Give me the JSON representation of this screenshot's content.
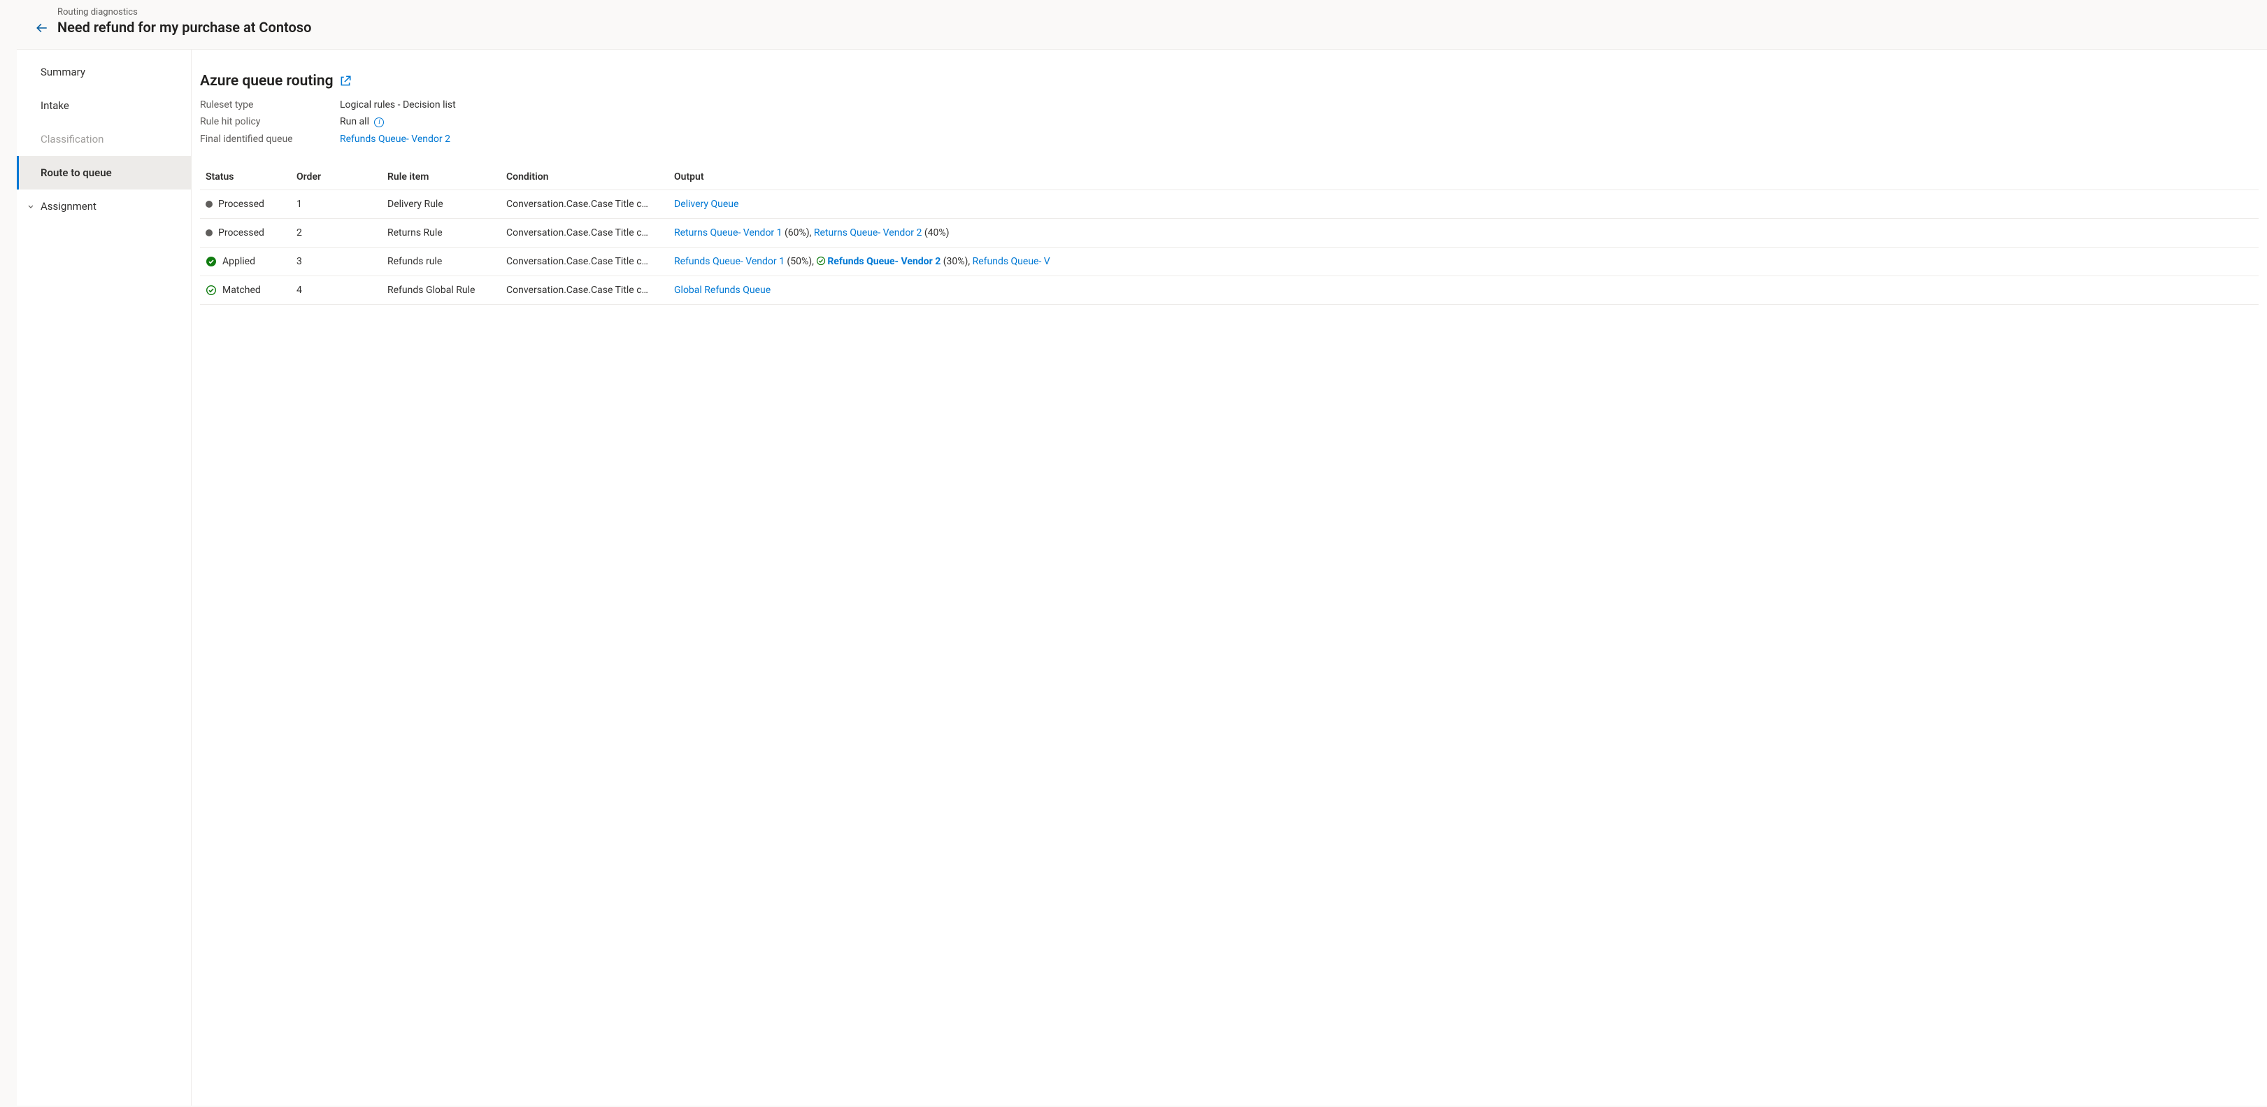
{
  "header": {
    "eyebrow": "Routing diagnostics",
    "title": "Need refund for my purchase at Contoso"
  },
  "sidebar": {
    "items": [
      {
        "label": "Summary",
        "selected": false,
        "expandable": false,
        "id": "summary"
      },
      {
        "label": "Intake",
        "selected": false,
        "expandable": false,
        "id": "intake"
      },
      {
        "label": "Classification",
        "selected": false,
        "expandable": false,
        "id": "classification",
        "disabled": true
      },
      {
        "label": "Route to queue",
        "selected": true,
        "expandable": false,
        "id": "route-to-queue"
      },
      {
        "label": "Assignment",
        "selected": false,
        "expandable": true,
        "id": "assignment"
      }
    ]
  },
  "content": {
    "title": "Azure queue routing",
    "meta": {
      "ruleset_type_label": "Ruleset type",
      "ruleset_type_value": "Logical rules - Decision list",
      "rule_hit_label": "Rule hit policy",
      "rule_hit_value": "Run all",
      "final_queue_label": "Final identified queue",
      "final_queue_value": "Refunds Queue- Vendor 2"
    },
    "columns": {
      "status": "Status",
      "order": "Order",
      "rule_item": "Rule item",
      "condition": "Condition",
      "output": "Output"
    },
    "rows": [
      {
        "status_kind": "processed",
        "status": "Processed",
        "order": "1",
        "rule_item": "Delivery Rule",
        "condition": "Conversation.Case.Case Title c…",
        "outputs": [
          {
            "link": "Delivery Queue",
            "pct": "",
            "highlight": false
          }
        ]
      },
      {
        "status_kind": "processed",
        "status": "Processed",
        "order": "2",
        "rule_item": "Returns Rule",
        "condition": "Conversation.Case.Case Title c…",
        "outputs": [
          {
            "link": "Returns Queue- Vendor 1",
            "pct": " (60%), ",
            "highlight": false
          },
          {
            "link": "Returns Queue- Vendor 2",
            "pct": " (40%)",
            "highlight": false
          }
        ]
      },
      {
        "status_kind": "applied",
        "status": "Applied",
        "order": "3",
        "rule_item": "Refunds rule",
        "condition": "Conversation.Case.Case Title c…",
        "outputs": [
          {
            "link": "Refunds Queue- Vendor 1",
            "pct": " (50%), ",
            "highlight": false
          },
          {
            "link": "Refunds Queue- Vendor 2",
            "pct": " (30%), ",
            "highlight": true
          },
          {
            "link": "Refunds Queue- V",
            "pct": "",
            "highlight": false
          }
        ]
      },
      {
        "status_kind": "matched",
        "status": "Matched",
        "order": "4",
        "rule_item": "Refunds Global Rule",
        "condition": "Conversation.Case.Case Title c…",
        "outputs": [
          {
            "link": "Global Refunds Queue",
            "pct": "",
            "highlight": false
          }
        ]
      }
    ]
  }
}
